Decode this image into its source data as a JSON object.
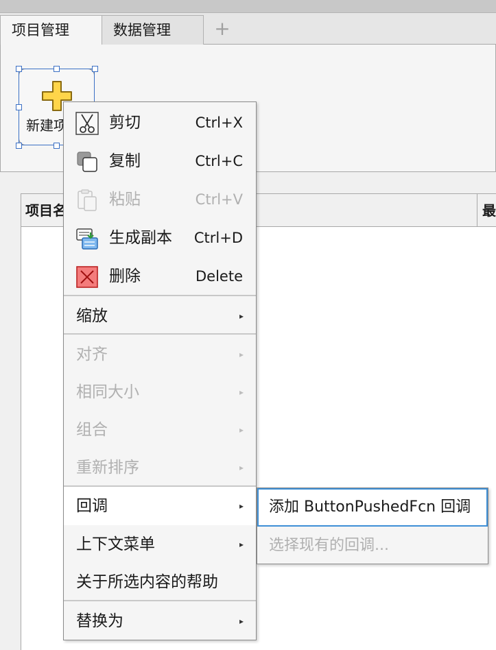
{
  "tabs": [
    {
      "label": "项目管理",
      "active": true
    },
    {
      "label": "数据管理",
      "active": false
    }
  ],
  "tab_add_label": "+",
  "canvas": {
    "new_button_label": "新建项"
  },
  "table": {
    "col1_header": "项目名",
    "col2_header": "最"
  },
  "menu": {
    "cut": {
      "label": "剪切",
      "shortcut": "Ctrl+X",
      "icon": "scissors-icon"
    },
    "copy": {
      "label": "复制",
      "shortcut": "Ctrl+C",
      "icon": "copy-icon"
    },
    "paste": {
      "label": "粘贴",
      "shortcut": "Ctrl+V",
      "icon": "paste-icon",
      "disabled": true
    },
    "duplicate": {
      "label": "生成副本",
      "shortcut": "Ctrl+D",
      "icon": "duplicate-icon"
    },
    "delete": {
      "label": "删除",
      "shortcut": "Delete",
      "icon": "delete-icon"
    },
    "zoom": {
      "label": "缩放"
    },
    "align": {
      "label": "对齐",
      "disabled": true
    },
    "same_size": {
      "label": "相同大小",
      "disabled": true
    },
    "group": {
      "label": "组合",
      "disabled": true
    },
    "reorder": {
      "label": "重新排序",
      "disabled": true
    },
    "callback": {
      "label": "回调",
      "highlighted": true
    },
    "context_menu": {
      "label": "上下文菜单"
    },
    "help": {
      "label": "关于所选内容的帮助"
    },
    "replace": {
      "label": "替换为"
    },
    "arrow_glyph": "▸"
  },
  "submenu": {
    "add_callback": "添加 ButtonPushedFcn 回调",
    "select_existing": "选择现有的回调..."
  },
  "colors": {
    "selection": "#3a6fc4",
    "focus_border": "#3d8fd6",
    "disabled_text": "#b0b0b0",
    "plus_fill": "#ffd54a"
  }
}
